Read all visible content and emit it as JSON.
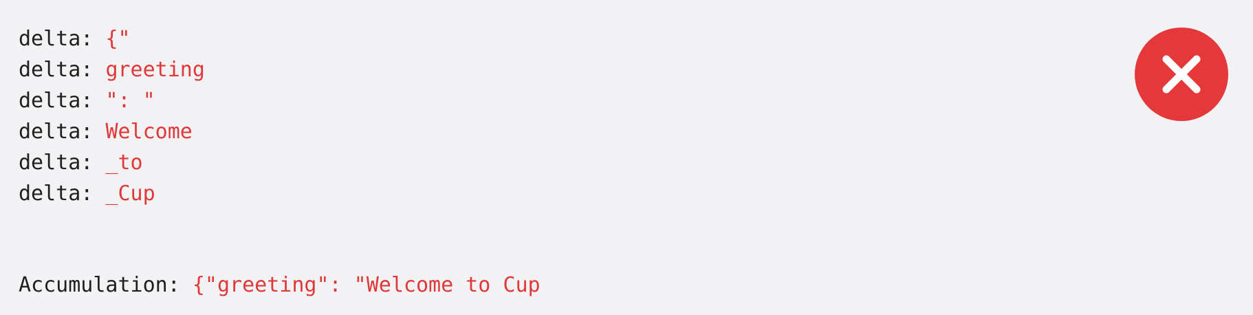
{
  "colors": {
    "background": "#f2f2f4",
    "key_text": "#1f1f1f",
    "value_text": "#e03838",
    "error": "#e5383b"
  },
  "stream": {
    "label": "delta:",
    "deltas": [
      "{\"",
      "greeting",
      "\": \"",
      "Welcome",
      "_to",
      "_Cup"
    ]
  },
  "accumulation": {
    "label": "Accumulation:",
    "value": "{\"greeting\": \"Welcome to Cup"
  },
  "status": {
    "icon": "close-icon"
  }
}
